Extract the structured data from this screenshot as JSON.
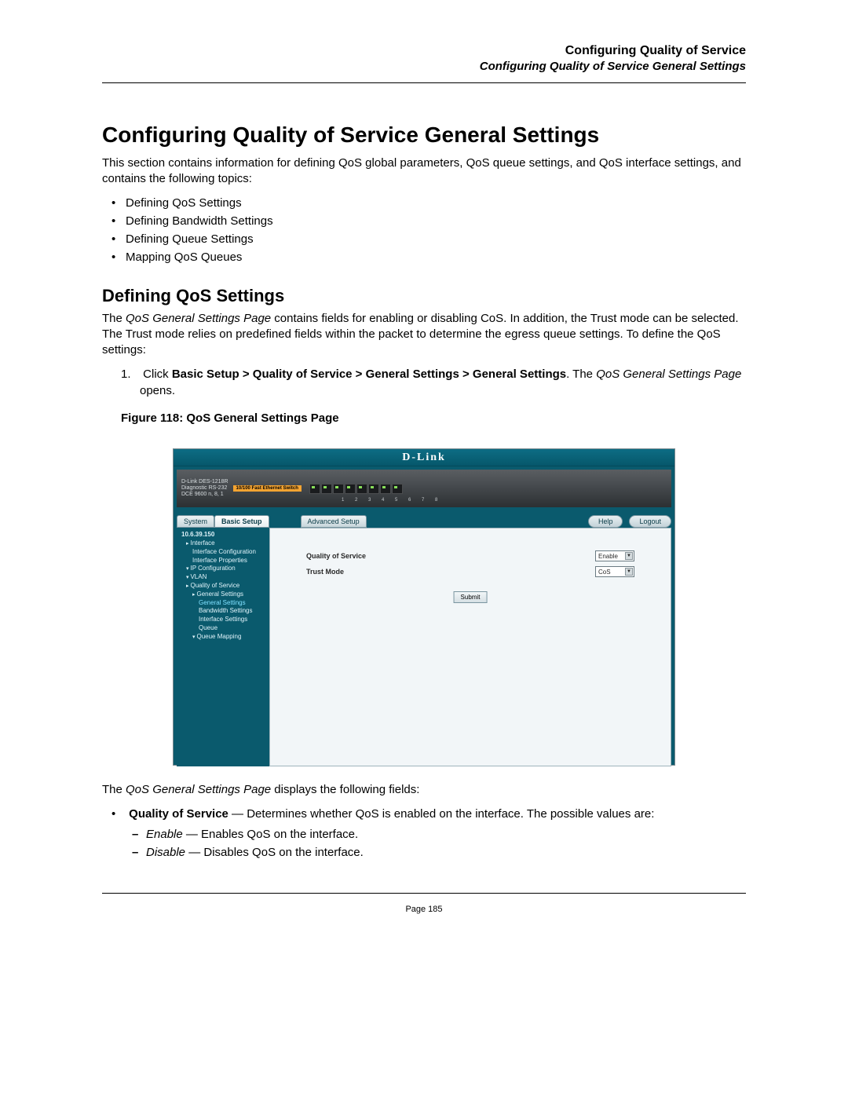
{
  "header": {
    "title": "Configuring Quality of Service",
    "subtitle": "Configuring Quality of Service General Settings"
  },
  "h1": "Configuring Quality of Service General Settings",
  "intro": "This section contains information for defining QoS global parameters, QoS queue settings, and QoS interface settings, and contains the following topics:",
  "topics": [
    "Defining QoS Settings",
    "Defining Bandwidth Settings",
    "Defining Queue Settings",
    "Mapping QoS Queues"
  ],
  "h2": "Defining QoS Settings",
  "section_intro_pre": "The ",
  "section_intro_em": "QoS General Settings Page",
  "section_intro_post": " contains fields for enabling or disabling CoS. In addition, the Trust mode can be selected. The Trust mode relies on predefined fields within the packet to determine the egress queue settings. To define the QoS settings:",
  "step": {
    "num": "1.",
    "pre": "Click ",
    "bold": "Basic Setup > Quality of Service > General Settings > General Settings",
    "mid": ". The ",
    "em": "QoS General Settings Page",
    "post": " opens."
  },
  "figure_caption": "Figure 118: QoS General Settings Page",
  "ui": {
    "brand": "D-Link",
    "device_model": "D-Link DES-1218R",
    "device_sub": "Diagnostic RS-232",
    "device_sub2": "DCE 9600 n, 8, 1",
    "fe_badge": "10/100 Fast Ethernet Switch",
    "port_nums": "1  2  3  4  5  6  7  8",
    "tabs": {
      "system": "System",
      "basic": "Basic Setup",
      "advanced": "Advanced Setup"
    },
    "buttons": {
      "help": "Help",
      "logout": "Logout"
    },
    "tree": {
      "ip": "10.6.39.150",
      "items": [
        "Interface",
        "Interface Configuration",
        "Interface Properties",
        "IP Configuration",
        "VLAN",
        "Quality of Service",
        "General Settings",
        "General Settings",
        "Bandwidth Settings",
        "Interface Settings",
        "Queue",
        "Queue Mapping"
      ]
    },
    "form": {
      "qos_label": "Quality of Service",
      "qos_value": "Enable",
      "trust_label": "Trust Mode",
      "trust_value": "CoS",
      "submit": "Submit"
    }
  },
  "after_figure_pre": "The ",
  "after_figure_em": "QoS General Settings Page",
  "after_figure_post": " displays the following fields:",
  "field": {
    "name": "Quality of Service",
    "desc": " — Determines whether QoS is enabled on the interface. The possible values are:",
    "enable_em": "Enable",
    "enable_desc": " — Enables QoS on the interface.",
    "disable_em": "Disable",
    "disable_desc": " — Disables QoS on the interface."
  },
  "page_num": "Page 185"
}
